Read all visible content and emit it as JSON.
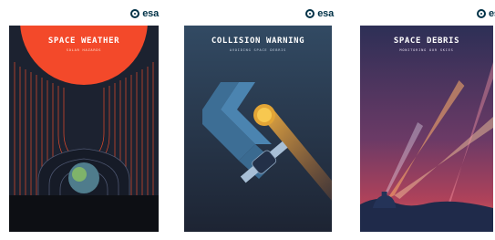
{
  "logo_text": "esa",
  "posters": [
    {
      "title": "SPACE WEATHER",
      "subtitle": "SOLAR HAZARDS",
      "colors": {
        "sun": "#f3492a",
        "lines": "#e24a2b",
        "bg": "#1c2230"
      }
    },
    {
      "title": "COLLISION WARNING",
      "subtitle": "AVOIDING SPACE DEBRIS",
      "colors": {
        "bg_top": "#324a63",
        "bg_bottom": "#1d2433",
        "beam": "#e9a93b"
      }
    },
    {
      "title": "SPACE DEBRIS",
      "subtitle": "MONITORING OUR SKIES",
      "colors": {
        "sky_top": "#2d2f56",
        "sky_mid": "#b0425a",
        "ground": "#1f2a4a"
      }
    }
  ]
}
